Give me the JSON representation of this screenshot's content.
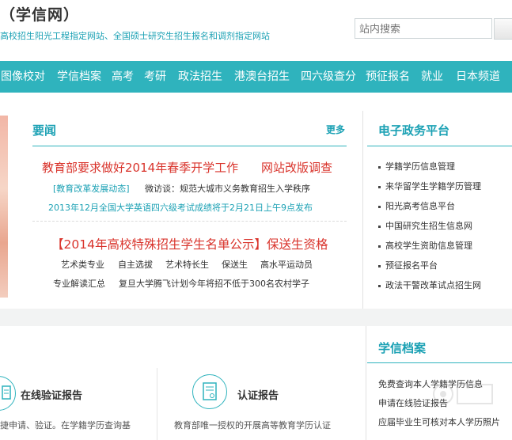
{
  "header": {
    "logo": "（学信网）",
    "tagline": "高校招生阳光工程指定网站、全国硕士研究生招生报名和调剂指定网站",
    "search_placeholder": "站内搜索"
  },
  "nav": {
    "items": [
      "图像校对",
      "学信档案",
      "高考",
      "考研",
      "政法招生",
      "港澳台招生",
      "四六级查分",
      "预征报名",
      "就业",
      "日本频道"
    ]
  },
  "news": {
    "title": "要闻",
    "more": "更多",
    "headline1_a": "教育部要求做好2014年春季开学工作",
    "headline1_b": "网站改版调查",
    "line2_tag": "[教育改革发展动态]",
    "line2_text": "微访谈：规范大城市义务教育招生入学秩序",
    "line3": "2013年12月全国大学英语四六级考试成绩将于2月21日上午9点发布",
    "headline2": "【2014年高校特殊招生学生名单公示】保送生资格",
    "tags": [
      "艺术类专业",
      "自主选拔",
      "艺术特长生",
      "保送生",
      "高水平运动员"
    ],
    "line6_a": "专业解读汇总",
    "line6_b": "复旦大学腾飞计划今年将招不低于300名农村学子"
  },
  "gov": {
    "title": "电子政务平台",
    "items": [
      "学籍学历信息管理",
      "来华留学生学籍学历管理",
      "阳光高考信息平台",
      "中国研究生招生信息网",
      "高校学生资助信息管理",
      "预征报名平台",
      "政法干警改革试点招生网"
    ]
  },
  "xuexin": {
    "title": "学信档案",
    "lines": [
      "免费查询本人学籍学历信息",
      "申请在线验证报告",
      "应届毕业生可核对本人学历照片"
    ]
  },
  "cards": {
    "card1_title": "在线验证报告",
    "card1_text": "捷申请、验证。在学籍学历查询基",
    "card2_title": "认证报告",
    "card2_text": "教育部唯一授权的开展高等教育学历认证"
  }
}
